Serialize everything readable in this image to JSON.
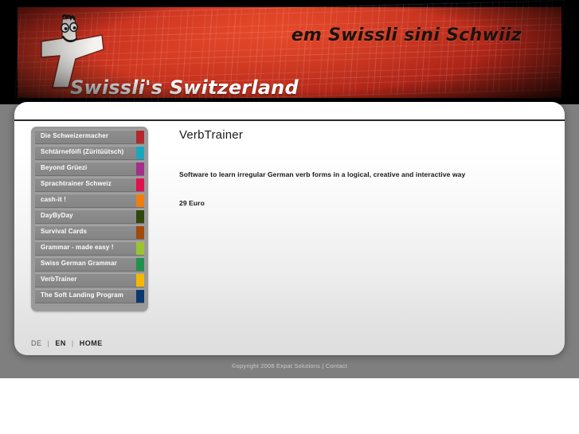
{
  "header": {
    "tagline": "em Swissli sini Schwiiz",
    "site_name": "Swissli's Switzerland",
    "logo_icon": "swiss-cross-mascot-icon",
    "background_color": "#b8281c"
  },
  "sidebar": {
    "items": [
      {
        "label": "Die Schweizermacher",
        "swatch": "#b4272e"
      },
      {
        "label": "Schtärneföifi (Züritüütsch)",
        "swatch": "#1ba6bf"
      },
      {
        "label": "Beyond Grüezi",
        "swatch": "#a32f8a"
      },
      {
        "label": "Sprachtrainer Schweiz",
        "swatch": "#e0114c"
      },
      {
        "label": "cash-it !",
        "swatch": "#f07d10"
      },
      {
        "label": "DayByDay",
        "swatch": "#31460d"
      },
      {
        "label": "Survival Cards",
        "swatch": "#a14a0a"
      },
      {
        "label": "Grammar - made easy !",
        "swatch": "#9ac431"
      },
      {
        "label": "Swiss German Grammar",
        "swatch": "#219150"
      },
      {
        "label": "VerbTrainer",
        "swatch": "#f5b800"
      },
      {
        "label": "The Soft Landing Program",
        "swatch": "#09386e"
      }
    ]
  },
  "content": {
    "title": "VerbTrainer",
    "description": "Software to learn irregular German verb forms in a logical, creative and interactive way",
    "price": "29 Euro"
  },
  "panel_footer": {
    "de_label": "DE",
    "separator": "|",
    "en_label": "EN",
    "home_label": "HOME"
  },
  "copyright": {
    "text": "©opyright 2008 Expat Solutions | Contact"
  }
}
